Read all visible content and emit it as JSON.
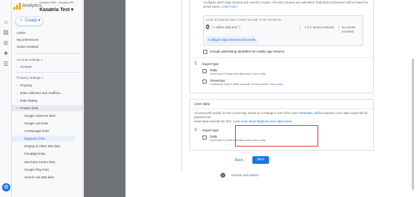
{
  "app": {
    "name": "Analytics",
    "account_line1": "Kasatria PRD",
    "account_line2": "Kasatria PR",
    "property": "Kasatria Test"
  },
  "sidebar": {
    "create_label": "Create",
    "items_top": [
      "Admin",
      "My preferences",
      "Setup Assistant"
    ],
    "account_settings": "Account settings",
    "account": "Account",
    "property_settings": "Property settings",
    "property": "Property",
    "data_collection": "Data collection and modifica...",
    "data_display": "Data display",
    "product_links": "Product links",
    "links": [
      "Google AdSense links",
      "Google Ads links",
      "Ad Manager links",
      "BigQuery links",
      "Display & Video 360 links",
      "Floodlight links",
      "Merchant Center links",
      "Google Play links",
      "Search Ads 360 links"
    ],
    "active_link_index": 3
  },
  "card1": {
    "desc_line1": "Configure which data streams and events to export. All event volumes are estimated. Daily limit enforcement will be based on",
    "desc_line2_prefix": "actual export.",
    "learn_more": "Learn more",
    "estimate_title": "TOTAL ESTIMATED DAILY EVENT VOLUME TO BE EXPORTED",
    "estimate_value": "0",
    "estimate_limit": "/ 1 million daily limit",
    "streams_selected": "1 of 1 stream selected",
    "events_excluded": "No events excluded",
    "configure_button": "Configure data streams and events",
    "include_ads_label": "Include advertising identifiers for mobile app streams",
    "export_type_title": "Export type",
    "daily_label": "Daily",
    "daily_desc": "A full export of data that takes place once a day.",
    "streaming_label": "Streaming",
    "streaming_desc_prefix": "Continuous export, within seconds of event arrival.",
    "streaming_learn_more": "Learn more"
  },
  "card2": {
    "title": "User data",
    "desc_line1_prefix": "All users with activity for the current day, based on a change in one of the user's",
    "desc_link1": "attributes",
    "desc_line1_suffix": ", will be exported. User data export will be passed if the",
    "desc_line2_prefix": "event data exceeds the limit.",
    "desc_link2": "Learn more about BigQuery user data export",
    "export_type_title": "Export type",
    "daily_label": "Daily",
    "daily_desc": "A full export of data that takes place once a day."
  },
  "footer": {
    "back_label": "Back",
    "next_label": "Next",
    "step_number": "3",
    "step_label": "Review and submit"
  },
  "colors": {
    "accent": "#1a73e8",
    "highlight": "#d93025",
    "logo": "#f9ab00"
  }
}
